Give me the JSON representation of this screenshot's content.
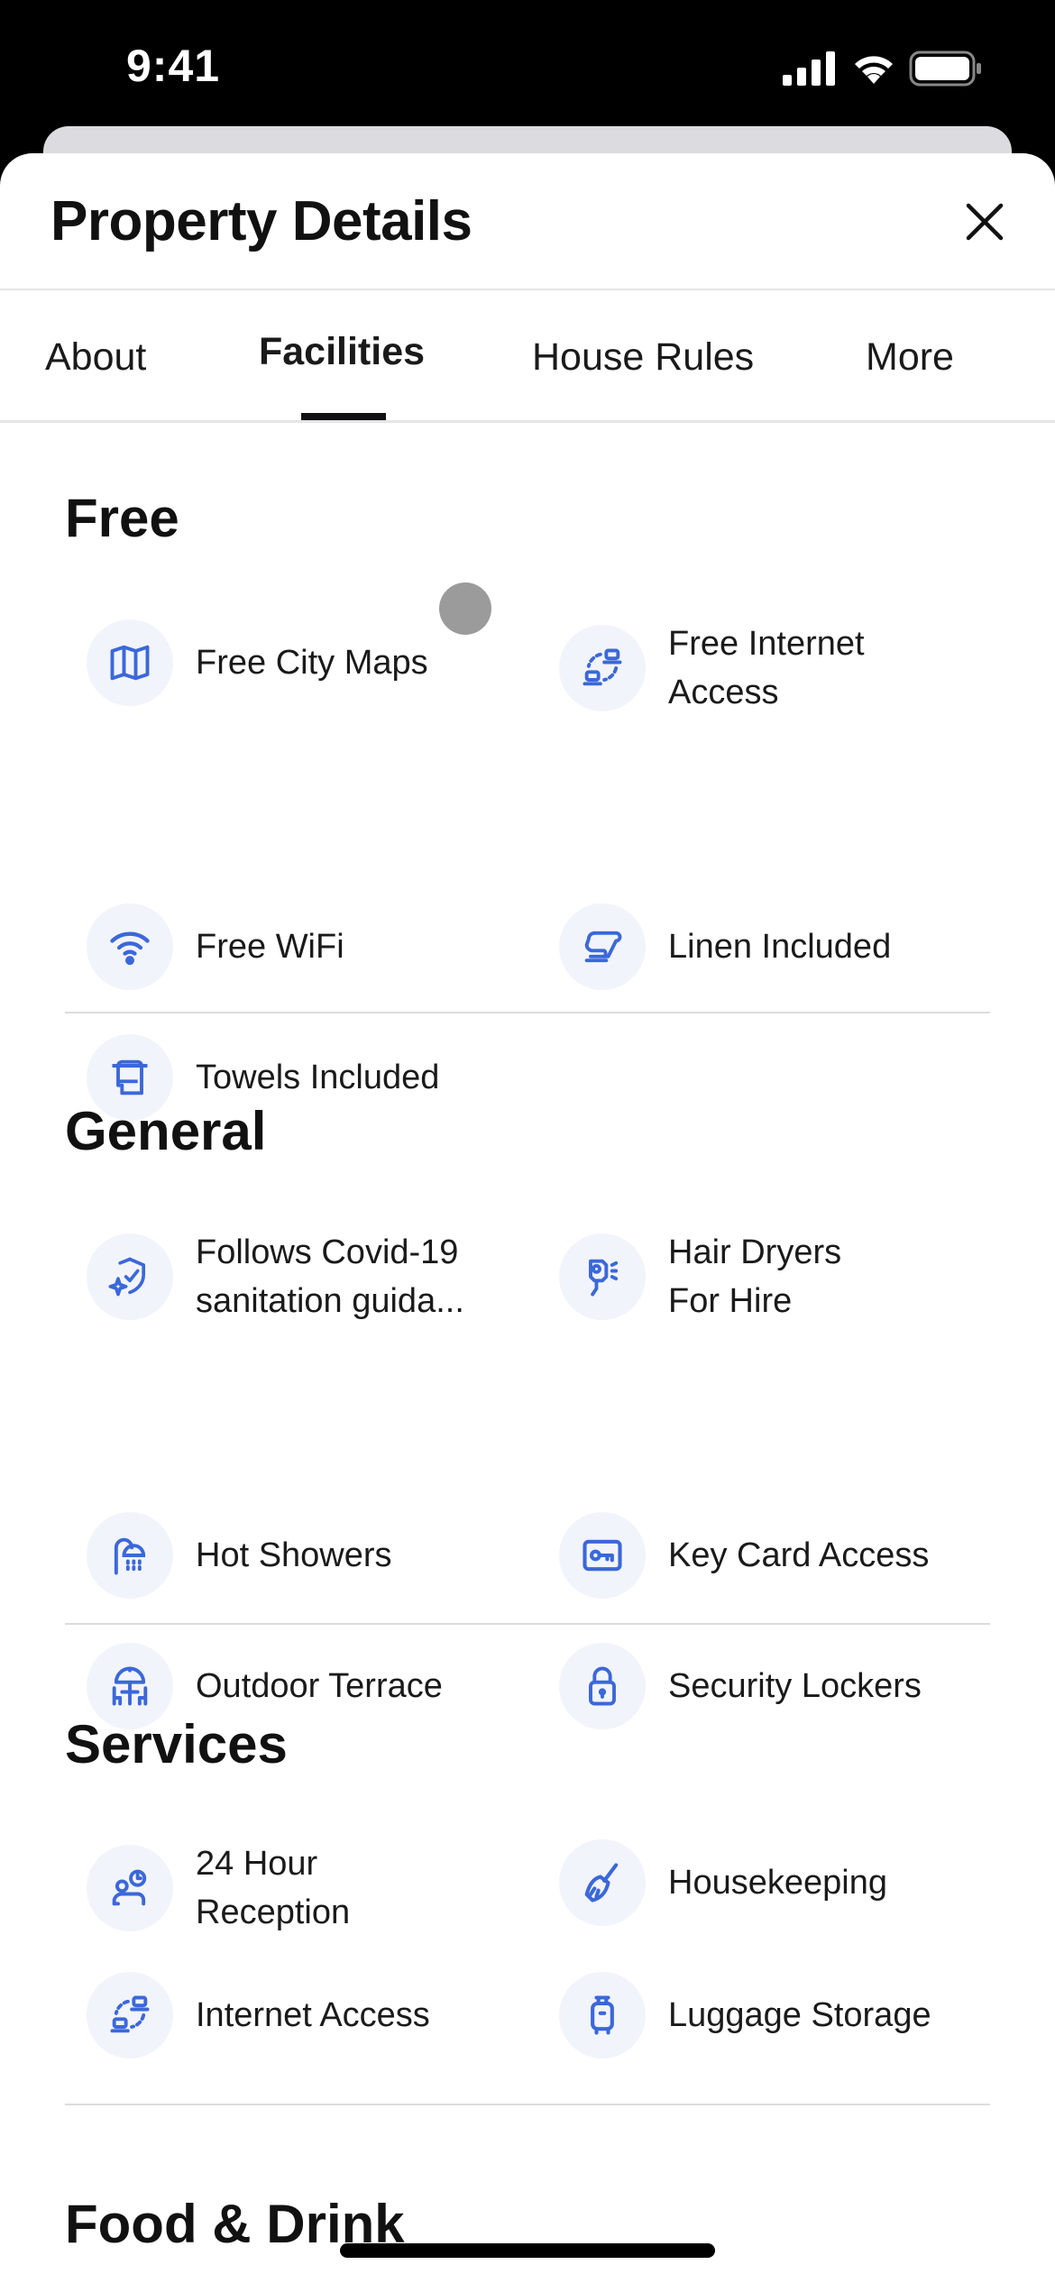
{
  "status_bar": {
    "time": "9:41",
    "icons": [
      "cellular-signal-icon",
      "wifi-icon",
      "battery-icon"
    ]
  },
  "header": {
    "title": "Property Details",
    "close_icon": "close-icon"
  },
  "tabs": [
    {
      "label": "About",
      "active": false
    },
    {
      "label": "Facilities",
      "active": true
    },
    {
      "label": "House Rules",
      "active": false
    },
    {
      "label": "More",
      "active": false
    }
  ],
  "colors": {
    "accent": "#3b68d9",
    "icon_bg": "#f2f4fb",
    "text": "#1a1a1a",
    "divider": "#dcdcdf"
  },
  "sections": [
    {
      "title": "Free",
      "items": [
        {
          "label": "Free City Maps",
          "icon": "map-icon"
        },
        {
          "label": "Free Internet\nAccess",
          "icon": "internet-access-icon"
        },
        {
          "label": "Free WiFi",
          "icon": "wifi-icon"
        },
        {
          "label": "Linen Included",
          "icon": "linen-icon"
        },
        {
          "label": "Towels Included",
          "icon": "towel-icon"
        }
      ]
    },
    {
      "title": "General",
      "items": [
        {
          "label": "Follows Covid-19\nsanitation guida...",
          "icon": "sanitation-shield-icon"
        },
        {
          "label": "Hair Dryers\nFor Hire",
          "icon": "hair-dryer-icon"
        },
        {
          "label": "Hot Showers",
          "icon": "shower-icon"
        },
        {
          "label": "Key Card Access",
          "icon": "key-card-icon"
        },
        {
          "label": "Outdoor Terrace",
          "icon": "terrace-icon"
        },
        {
          "label": "Security Lockers",
          "icon": "lock-icon"
        }
      ]
    },
    {
      "title": "Services",
      "items": [
        {
          "label": "24 Hour\nReception",
          "icon": "reception-icon"
        },
        {
          "label": "Housekeeping",
          "icon": "broom-icon"
        },
        {
          "label": "Internet Access",
          "icon": "internet-access-icon"
        },
        {
          "label": "Luggage Storage",
          "icon": "luggage-icon"
        }
      ]
    },
    {
      "title": "Food & Drink",
      "items": []
    }
  ]
}
